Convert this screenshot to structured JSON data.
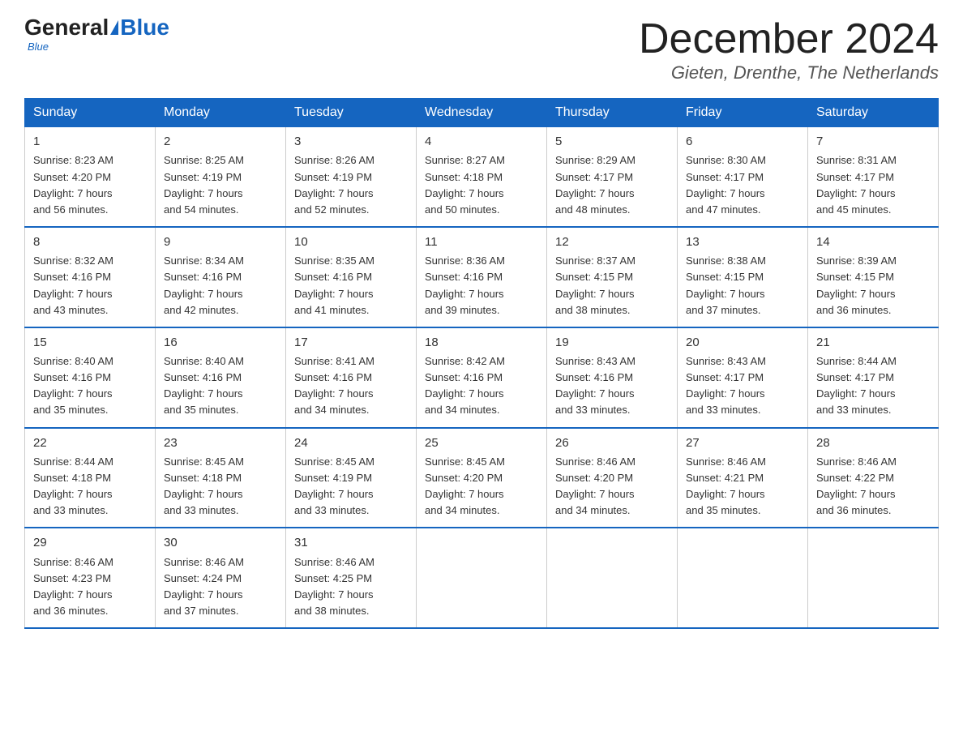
{
  "header": {
    "logo_general": "General",
    "logo_blue": "Blue",
    "month_year": "December 2024",
    "location": "Gieten, Drenthe, The Netherlands"
  },
  "days_of_week": [
    "Sunday",
    "Monday",
    "Tuesday",
    "Wednesday",
    "Thursday",
    "Friday",
    "Saturday"
  ],
  "weeks": [
    [
      {
        "day": "1",
        "sunrise": "8:23 AM",
        "sunset": "4:20 PM",
        "daylight": "7 hours and 56 minutes."
      },
      {
        "day": "2",
        "sunrise": "8:25 AM",
        "sunset": "4:19 PM",
        "daylight": "7 hours and 54 minutes."
      },
      {
        "day": "3",
        "sunrise": "8:26 AM",
        "sunset": "4:19 PM",
        "daylight": "7 hours and 52 minutes."
      },
      {
        "day": "4",
        "sunrise": "8:27 AM",
        "sunset": "4:18 PM",
        "daylight": "7 hours and 50 minutes."
      },
      {
        "day": "5",
        "sunrise": "8:29 AM",
        "sunset": "4:17 PM",
        "daylight": "7 hours and 48 minutes."
      },
      {
        "day": "6",
        "sunrise": "8:30 AM",
        "sunset": "4:17 PM",
        "daylight": "7 hours and 47 minutes."
      },
      {
        "day": "7",
        "sunrise": "8:31 AM",
        "sunset": "4:17 PM",
        "daylight": "7 hours and 45 minutes."
      }
    ],
    [
      {
        "day": "8",
        "sunrise": "8:32 AM",
        "sunset": "4:16 PM",
        "daylight": "7 hours and 43 minutes."
      },
      {
        "day": "9",
        "sunrise": "8:34 AM",
        "sunset": "4:16 PM",
        "daylight": "7 hours and 42 minutes."
      },
      {
        "day": "10",
        "sunrise": "8:35 AM",
        "sunset": "4:16 PM",
        "daylight": "7 hours and 41 minutes."
      },
      {
        "day": "11",
        "sunrise": "8:36 AM",
        "sunset": "4:16 PM",
        "daylight": "7 hours and 39 minutes."
      },
      {
        "day": "12",
        "sunrise": "8:37 AM",
        "sunset": "4:15 PM",
        "daylight": "7 hours and 38 minutes."
      },
      {
        "day": "13",
        "sunrise": "8:38 AM",
        "sunset": "4:15 PM",
        "daylight": "7 hours and 37 minutes."
      },
      {
        "day": "14",
        "sunrise": "8:39 AM",
        "sunset": "4:15 PM",
        "daylight": "7 hours and 36 minutes."
      }
    ],
    [
      {
        "day": "15",
        "sunrise": "8:40 AM",
        "sunset": "4:16 PM",
        "daylight": "7 hours and 35 minutes."
      },
      {
        "day": "16",
        "sunrise": "8:40 AM",
        "sunset": "4:16 PM",
        "daylight": "7 hours and 35 minutes."
      },
      {
        "day": "17",
        "sunrise": "8:41 AM",
        "sunset": "4:16 PM",
        "daylight": "7 hours and 34 minutes."
      },
      {
        "day": "18",
        "sunrise": "8:42 AM",
        "sunset": "4:16 PM",
        "daylight": "7 hours and 34 minutes."
      },
      {
        "day": "19",
        "sunrise": "8:43 AM",
        "sunset": "4:16 PM",
        "daylight": "7 hours and 33 minutes."
      },
      {
        "day": "20",
        "sunrise": "8:43 AM",
        "sunset": "4:17 PM",
        "daylight": "7 hours and 33 minutes."
      },
      {
        "day": "21",
        "sunrise": "8:44 AM",
        "sunset": "4:17 PM",
        "daylight": "7 hours and 33 minutes."
      }
    ],
    [
      {
        "day": "22",
        "sunrise": "8:44 AM",
        "sunset": "4:18 PM",
        "daylight": "7 hours and 33 minutes."
      },
      {
        "day": "23",
        "sunrise": "8:45 AM",
        "sunset": "4:18 PM",
        "daylight": "7 hours and 33 minutes."
      },
      {
        "day": "24",
        "sunrise": "8:45 AM",
        "sunset": "4:19 PM",
        "daylight": "7 hours and 33 minutes."
      },
      {
        "day": "25",
        "sunrise": "8:45 AM",
        "sunset": "4:20 PM",
        "daylight": "7 hours and 34 minutes."
      },
      {
        "day": "26",
        "sunrise": "8:46 AM",
        "sunset": "4:20 PM",
        "daylight": "7 hours and 34 minutes."
      },
      {
        "day": "27",
        "sunrise": "8:46 AM",
        "sunset": "4:21 PM",
        "daylight": "7 hours and 35 minutes."
      },
      {
        "day": "28",
        "sunrise": "8:46 AM",
        "sunset": "4:22 PM",
        "daylight": "7 hours and 36 minutes."
      }
    ],
    [
      {
        "day": "29",
        "sunrise": "8:46 AM",
        "sunset": "4:23 PM",
        "daylight": "7 hours and 36 minutes."
      },
      {
        "day": "30",
        "sunrise": "8:46 AM",
        "sunset": "4:24 PM",
        "daylight": "7 hours and 37 minutes."
      },
      {
        "day": "31",
        "sunrise": "8:46 AM",
        "sunset": "4:25 PM",
        "daylight": "7 hours and 38 minutes."
      },
      null,
      null,
      null,
      null
    ]
  ],
  "labels": {
    "sunrise": "Sunrise:",
    "sunset": "Sunset:",
    "daylight": "Daylight:"
  }
}
